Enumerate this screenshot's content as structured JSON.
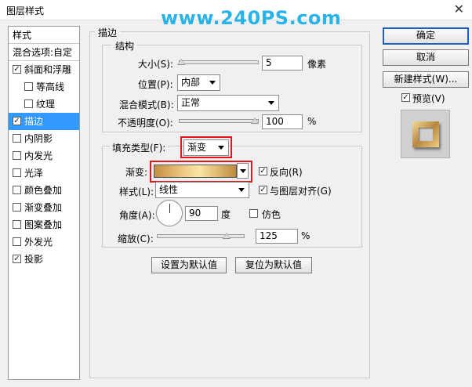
{
  "window": {
    "title": "图层样式",
    "close_glyph": "✕",
    "watermark": "www.240PS.com"
  },
  "left_panel": {
    "header": "样式",
    "blend_options": "混合选项:自定",
    "items": [
      {
        "label": "斜面和浮雕",
        "checked": true,
        "indent": false,
        "selected": false
      },
      {
        "label": "等高线",
        "checked": false,
        "indent": true,
        "selected": false
      },
      {
        "label": "纹理",
        "checked": false,
        "indent": true,
        "selected": false
      },
      {
        "label": "描边",
        "checked": true,
        "indent": false,
        "selected": true
      },
      {
        "label": "内阴影",
        "checked": false,
        "indent": false,
        "selected": false
      },
      {
        "label": "内发光",
        "checked": false,
        "indent": false,
        "selected": false
      },
      {
        "label": "光泽",
        "checked": false,
        "indent": false,
        "selected": false
      },
      {
        "label": "颜色叠加",
        "checked": false,
        "indent": false,
        "selected": false
      },
      {
        "label": "渐变叠加",
        "checked": false,
        "indent": false,
        "selected": false
      },
      {
        "label": "图案叠加",
        "checked": false,
        "indent": false,
        "selected": false
      },
      {
        "label": "外发光",
        "checked": false,
        "indent": false,
        "selected": false
      },
      {
        "label": "投影",
        "checked": true,
        "indent": false,
        "selected": false
      }
    ]
  },
  "stroke": {
    "section_title": "描边",
    "structure_title": "结构",
    "size_label": "大小(S):",
    "size_value": "5",
    "size_unit": "像素",
    "position_label": "位置(P):",
    "position_value": "内部",
    "blend_label": "混合模式(B):",
    "blend_value": "正常",
    "opacity_label": "不透明度(O):",
    "opacity_value": "100",
    "opacity_unit": "%",
    "fill_type_label": "填充类型(F):",
    "fill_type_value": "渐变",
    "gradient_label": "渐变:",
    "reverse_label": "反向(R)",
    "reverse_checked": true,
    "style_label": "样式(L):",
    "style_value": "线性",
    "align_label": "与图层对齐(G)",
    "align_checked": true,
    "angle_label": "角度(A):",
    "angle_value": "90",
    "angle_unit": "度",
    "dither_label": "仿色",
    "dither_checked": false,
    "scale_label": "缩放(C):",
    "scale_value": "125",
    "scale_unit": "%",
    "make_default_label": "设置为默认值",
    "reset_default_label": "复位为默认值"
  },
  "right": {
    "ok_label": "确定",
    "cancel_label": "取消",
    "new_style_label": "新建样式(W)...",
    "preview_label": "预览(V)",
    "preview_checked": true
  },
  "check_glyph": "✓",
  "colors": {
    "selection": "#3399ff",
    "highlight_box": "#e8141a",
    "watermark": "#2ab3e8"
  }
}
